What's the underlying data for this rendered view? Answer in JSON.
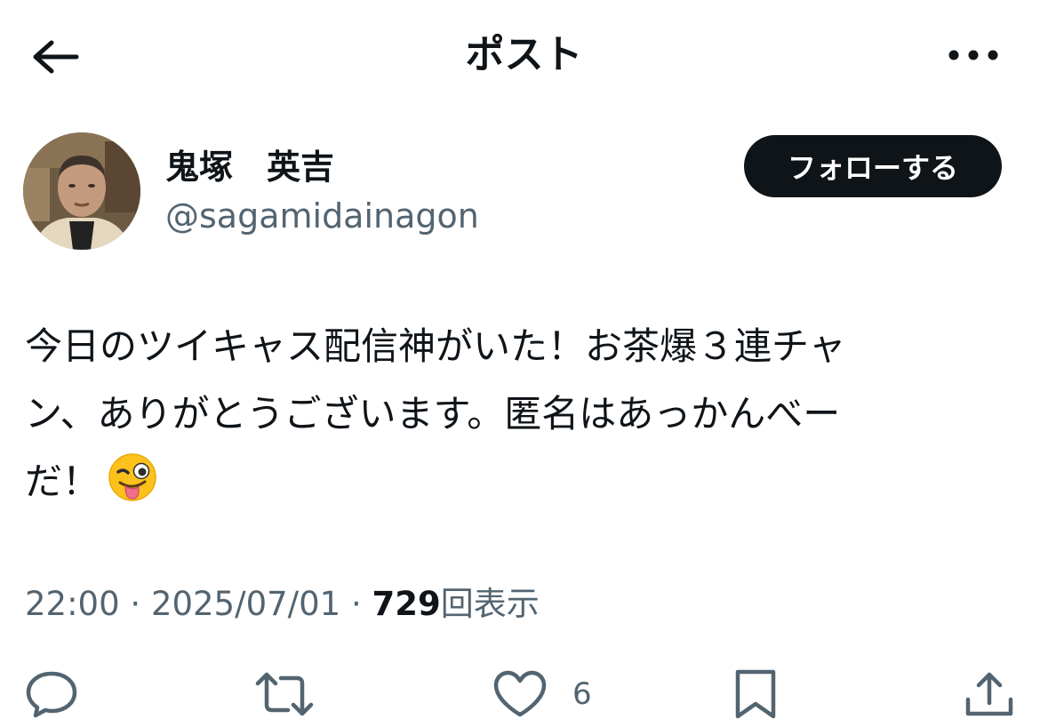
{
  "header": {
    "title": "ポスト"
  },
  "author": {
    "display_name": "鬼塚　英吉",
    "handle": "@sagamidainagon",
    "follow_label": "フォローする"
  },
  "post": {
    "lines": [
      "今日のツイキャス配信神がいた！お茶爆３連チャ",
      "ン、ありがとうございます。匿名はあっかんべー",
      "だ！"
    ],
    "emoji": "winking-face-with-tongue"
  },
  "meta": {
    "time": "22:00",
    "separator": "·",
    "date": "2025/07/01",
    "views_count": "729",
    "views_label": "回表示"
  },
  "actions": {
    "like_count": "6"
  },
  "colors": {
    "text": "#0f1419",
    "secondary": "#536471",
    "button_bg": "#0f1419",
    "background": "#ffffff"
  },
  "icons": [
    "back-arrow-icon",
    "more-icon",
    "reply-icon",
    "repost-icon",
    "like-icon",
    "bookmark-icon",
    "share-icon"
  ]
}
